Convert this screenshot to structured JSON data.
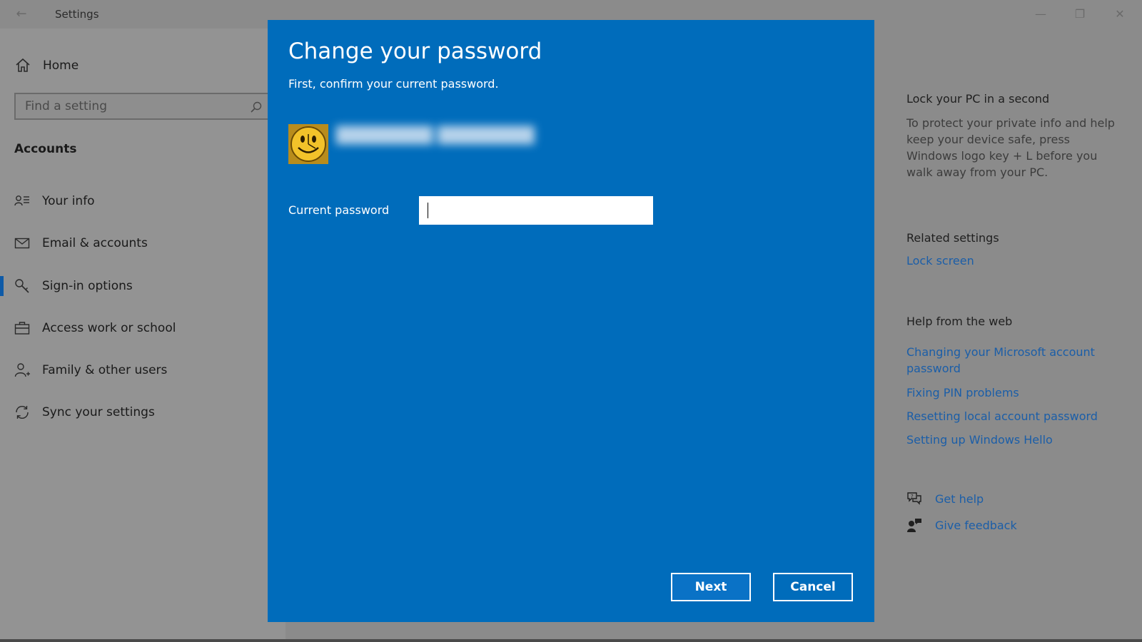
{
  "window": {
    "app_title": "Settings",
    "back_glyph": "←",
    "minimize_glyph": "—",
    "restore_glyph": "❐",
    "close_glyph": "✕"
  },
  "sidebar": {
    "home_label": "Home",
    "search_placeholder": "Find a setting",
    "section_title": "Accounts",
    "items": [
      {
        "label": "Your info",
        "icon": "your-info-icon"
      },
      {
        "label": "Email & accounts",
        "icon": "mail-icon"
      },
      {
        "label": "Sign-in options",
        "icon": "key-icon",
        "active": true
      },
      {
        "label": "Access work or school",
        "icon": "briefcase-icon"
      },
      {
        "label": "Family & other users",
        "icon": "person-add-icon"
      },
      {
        "label": "Sync your settings",
        "icon": "sync-icon"
      }
    ]
  },
  "right_panel": {
    "lock_heading": "Lock your PC in a second",
    "lock_text": "To protect your private info and help keep your device safe, press Windows logo key + L before you walk away from your PC.",
    "related_heading": "Related settings",
    "related_link": "Lock screen",
    "help_heading": "Help from the web",
    "help_links": [
      "Changing your Microsoft account password",
      "Fixing PIN problems",
      "Resetting local account password",
      "Setting up Windows Hello"
    ],
    "get_help": "Get help",
    "give_feedback": "Give feedback"
  },
  "dialog": {
    "title": "Change your password",
    "subtitle": "First, confirm your current password.",
    "password_label": "Current password",
    "password_value": "",
    "next_label": "Next",
    "cancel_label": "Cancel"
  },
  "colors": {
    "dialog_bg": "#006cbb",
    "link": "#1b5ea8",
    "overlay": "#8b8b8b"
  }
}
